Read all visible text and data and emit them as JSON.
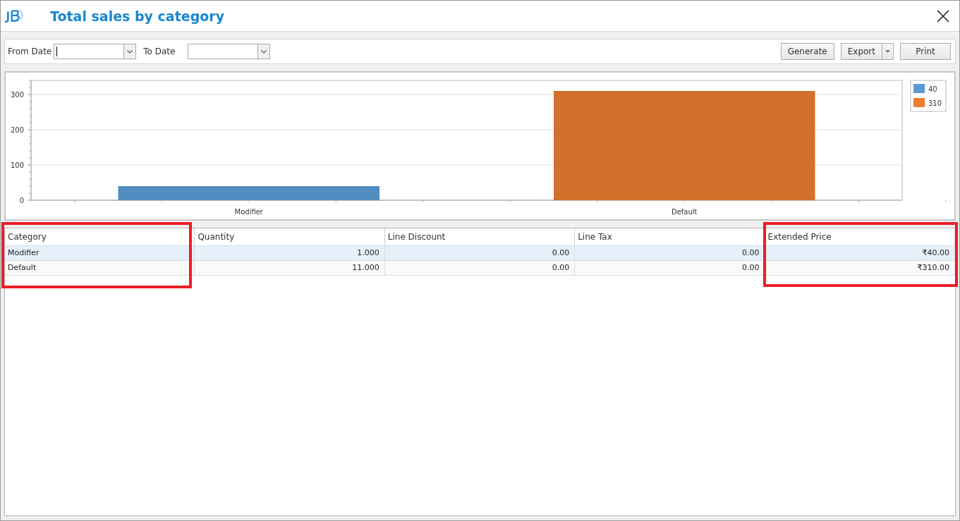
{
  "window": {
    "title": "Total sales by category"
  },
  "filters": {
    "from_label": "From Date",
    "to_label": "To Date"
  },
  "buttons": {
    "generate": "Generate",
    "export": "Export",
    "print": "Print"
  },
  "chart": {
    "chart_data": {
      "type": "bar",
      "grid": true,
      "legend": true,
      "categories": [
        "Modifier",
        "Default"
      ],
      "ylim": [
        0,
        340
      ],
      "yticks": [
        0,
        100,
        200,
        300
      ],
      "series": [
        {
          "name": "40",
          "color": "#5b9bd5",
          "values": [
            40,
            null
          ]
        },
        {
          "name": "310",
          "color": "#ed7d31",
          "values": [
            null,
            310
          ]
        }
      ]
    }
  },
  "table": {
    "columns": [
      "Category",
      "Quantity",
      "Line Discount",
      "Line Tax",
      "Extended Price"
    ],
    "rows": [
      {
        "selected": true,
        "cells": [
          "Modifier",
          "1.000",
          "0.00",
          "0.00",
          "₹40.00"
        ]
      },
      {
        "selected": false,
        "cells": [
          "Default",
          "11.000",
          "0.00",
          "0.00",
          "₹310.00"
        ]
      }
    ]
  }
}
